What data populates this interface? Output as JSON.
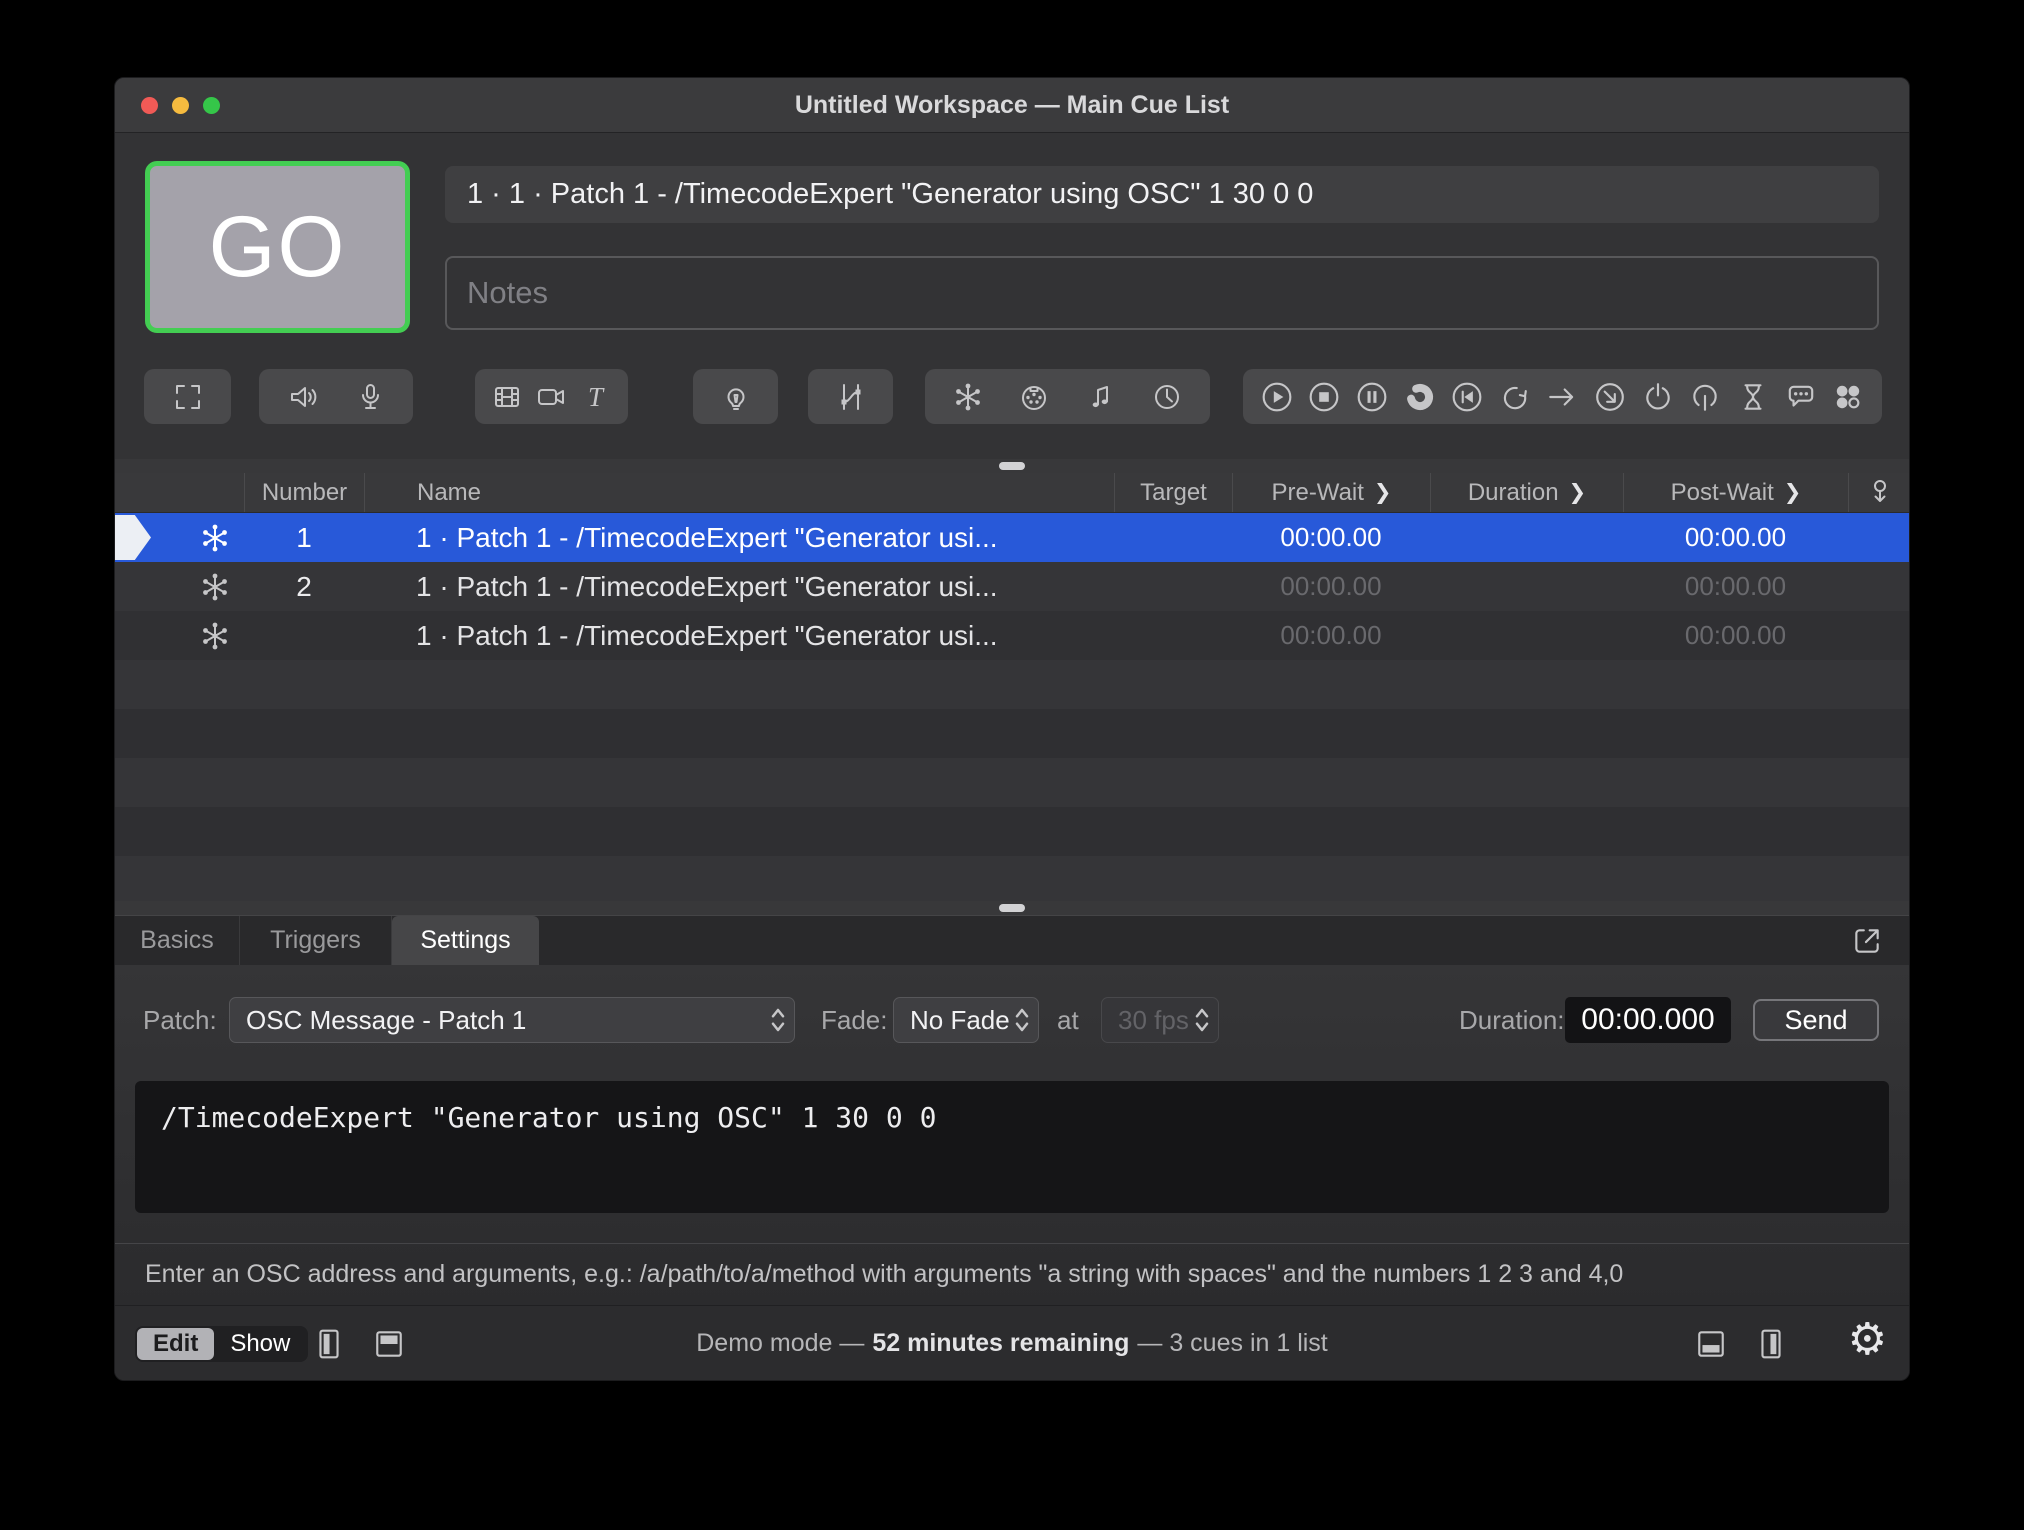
{
  "window": {
    "title": "Untitled Workspace — Main Cue List"
  },
  "header": {
    "go_label": "GO",
    "cue_title": "1 · 1 · Patch 1 - /TimecodeExpert \"Generator using OSC\" 1 30 0 0",
    "notes_placeholder": "Notes"
  },
  "toolbar": {
    "groups": [
      {
        "icons": [
          "group-icon"
        ]
      },
      {
        "icons": [
          "audio-icon",
          "mic-icon"
        ]
      },
      {
        "icons": [
          "video-icon",
          "camera-icon",
          "text-icon"
        ]
      },
      {
        "icons": [
          "light-icon"
        ]
      },
      {
        "icons": [
          "fade-icon"
        ]
      },
      {
        "icons": [
          "network-icon",
          "midi-icon",
          "music-icon",
          "timecode-icon"
        ]
      },
      {
        "icons": [
          "play-icon",
          "stop-icon",
          "pause-icon",
          "load-icon",
          "reset-icon",
          "devamp-icon",
          "goto-icon",
          "retarget-icon",
          "power-icon",
          "arm-icon",
          "wait-icon",
          "memo-icon",
          "cart-icon"
        ]
      }
    ]
  },
  "cue_list": {
    "columns": {
      "number": "Number",
      "name": "Name",
      "target": "Target",
      "pre_wait": "Pre-Wait",
      "duration": "Duration",
      "post_wait": "Post-Wait"
    },
    "rows": [
      {
        "number": "1",
        "name": "1 · Patch 1 - /TimecodeExpert \"Generator usi...",
        "target": "",
        "pre_wait": "00:00.00",
        "duration": "",
        "post_wait": "00:00.00"
      },
      {
        "number": "2",
        "name": "1 · Patch 1 - /TimecodeExpert \"Generator usi...",
        "target": "",
        "pre_wait": "00:00.00",
        "duration": "",
        "post_wait": "00:00.00"
      },
      {
        "number": "",
        "name": "1 · Patch 1 - /TimecodeExpert \"Generator usi...",
        "target": "",
        "pre_wait": "00:00.00",
        "duration": "",
        "post_wait": "00:00.00"
      }
    ]
  },
  "inspector": {
    "tabs": [
      {
        "label": "Basics"
      },
      {
        "label": "Triggers"
      },
      {
        "label": "Settings"
      }
    ],
    "patch_label": "Patch:",
    "patch_value": "OSC Message - Patch 1",
    "fade_label": "Fade:",
    "fade_value": "No Fade",
    "at_label": "at",
    "fps_value": "30 fps",
    "duration_label": "Duration:",
    "duration_value": "00:00.000",
    "send_label": "Send",
    "osc_message": "/TimecodeExpert \"Generator using OSC\" 1 30 0 0",
    "help_text": "Enter an OSC address and arguments, e.g.: /a/path/to/a/method with arguments \"a string with spaces\" and the numbers 1 2 3 and 4,0"
  },
  "status_bar": {
    "edit_label": "Edit",
    "show_label": "Show",
    "status_prefix": "Demo mode —",
    "status_bold": "52 minutes remaining",
    "status_suffix": "— 3 cues in 1 list"
  },
  "colors": {
    "selection_blue": "#2859d9",
    "go_green_border": "#43cd52",
    "go_gray": "#a4a2aa",
    "window_bg": "#333335"
  }
}
